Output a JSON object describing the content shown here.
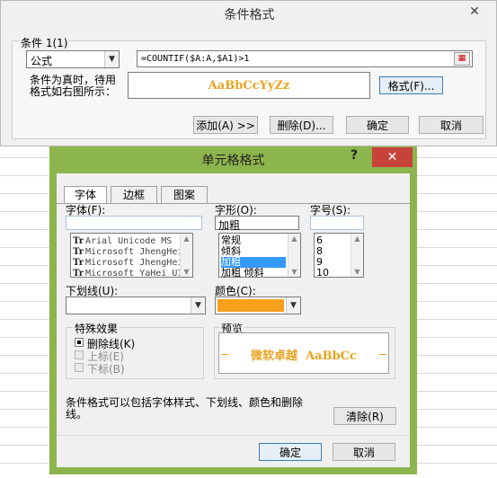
{
  "cf_dialog": {
    "title": "条件格式",
    "close_icon": "close-icon",
    "condition_label": "条件 1(1)",
    "type_select": "公式",
    "formula": "=COUNTIF($A:A,$A1)>1",
    "preview_desc_line1": "条件为真时，待用",
    "preview_desc_line2": "格式如右图所示：",
    "preview_sample": "AaBbCcYyZz",
    "format_button": "格式(F)...",
    "add_button": "添加(A) >>",
    "delete_button": "删除(D)...",
    "ok_button": "确定",
    "cancel_button": "取消"
  },
  "cell_dialog": {
    "title": "单元格格式",
    "help": "?",
    "tabs": [
      "字体",
      "边框",
      "图案"
    ],
    "font_label": "字体(F):",
    "font_value": "",
    "font_list": [
      "Arial Unicode MS",
      "Microsoft JhengHei",
      "Microsoft JhengHei",
      "Microsoft YaHei UI"
    ],
    "style_label": "字形(O):",
    "style_value": "加粗",
    "style_list": [
      "常规",
      "倾斜",
      "加粗",
      "加粗 倾斜"
    ],
    "size_label": "字号(S):",
    "size_value": "",
    "size_list": [
      "6",
      "8",
      "9",
      "10"
    ],
    "underline_label": "下划线(U):",
    "underline_value": "",
    "color_label": "颜色(C):",
    "color_swatch": "#f7a01c",
    "effects_label": "特殊效果",
    "strike_label": "删除线(K)",
    "super_label": "上标(E)",
    "sub_label": "下标(B)",
    "preview_label": "预览",
    "preview_sample": "微软卓越  AaBbCc",
    "note": "条件格式可以包括字体样式、下划线、颜色和删除线。",
    "clear_button": "清除(R)",
    "ok_button": "确定",
    "cancel_button": "取消"
  },
  "colors": {
    "accent_orange": "#e8a31f",
    "title_green": "#8db54d",
    "close_red": "#c7433a"
  }
}
